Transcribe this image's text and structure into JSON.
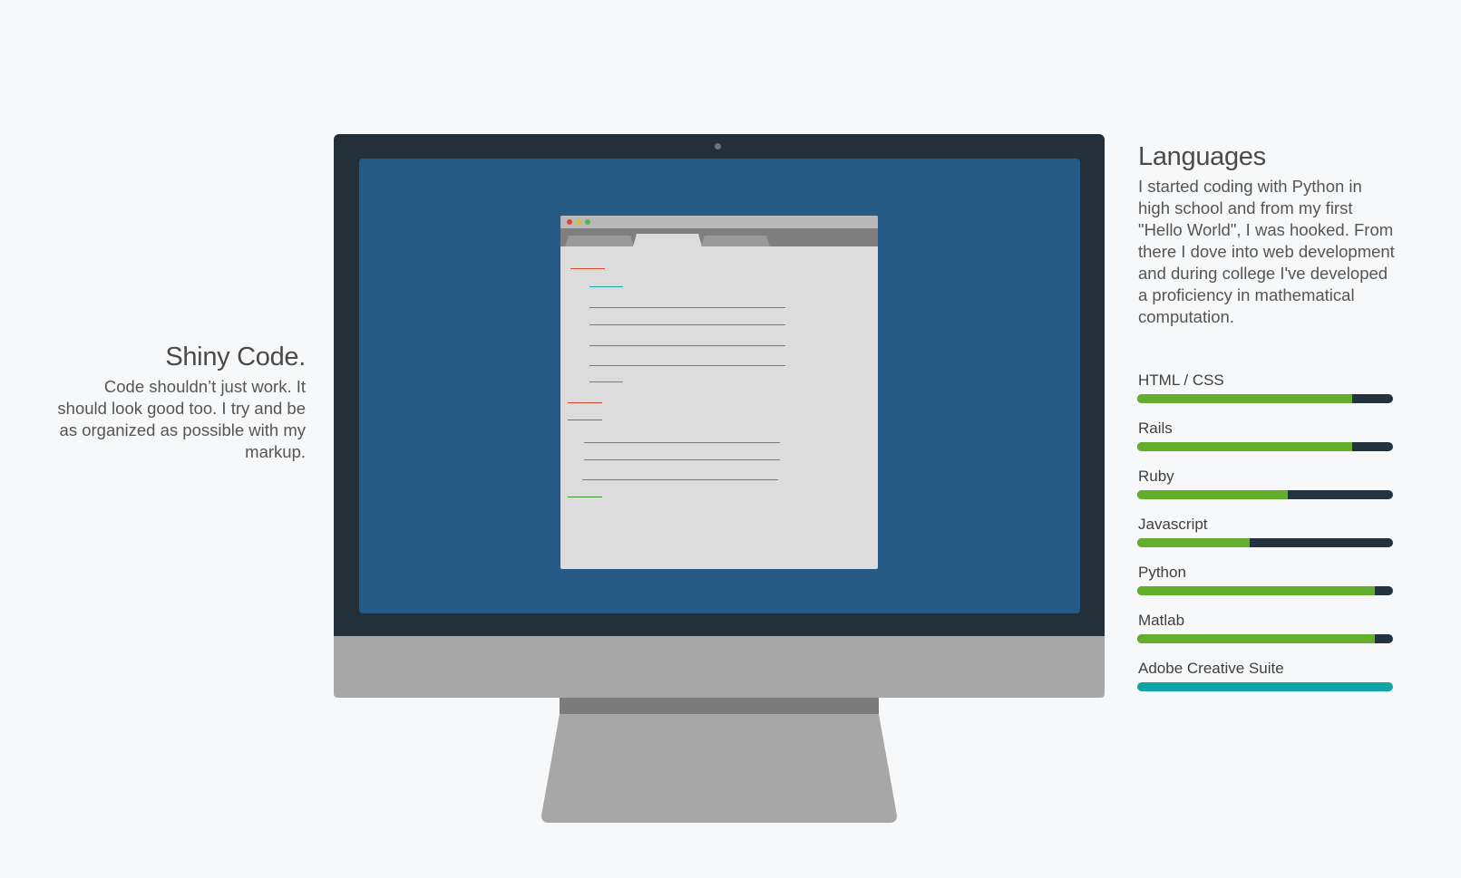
{
  "left": {
    "title": "Shiny Code.",
    "description": "Code shouldn’t just work. It should look good too. I try and be as organized as possible with my markup."
  },
  "right": {
    "title": "Languages",
    "description": "I started coding with Python in high school and from my first \"Hello World\", I was hooked. From there I dove into web development and during college I've developed a proficiency in mathematical computation."
  },
  "skills": [
    {
      "label": "HTML / CSS",
      "level": 0.84,
      "color": "#63ae2c",
      "track": "#243340"
    },
    {
      "label": "Rails",
      "level": 0.84,
      "color": "#63ae2c",
      "track": "#243340"
    },
    {
      "label": "Ruby",
      "level": 0.59,
      "color": "#63ae2c",
      "track": "#243340"
    },
    {
      "label": "Javascript",
      "level": 0.44,
      "color": "#63ae2c",
      "track": "#243340"
    },
    {
      "label": "Python",
      "level": 0.93,
      "color": "#63ae2c",
      "track": "#243340"
    },
    {
      "label": "Matlab",
      "level": 0.93,
      "color": "#63ae2c",
      "track": "#243340"
    },
    {
      "label": "Adobe Creative Suite",
      "level": 1.0,
      "color": "#10a3a8",
      "track": "#10a3a8"
    }
  ],
  "colors": {
    "background": "#f7f8f9",
    "bezel": "#232f39",
    "screen": "#275b85",
    "chin": "#a7a7a7",
    "green_fill": "#63ae2c",
    "teal_fill": "#10a3a8"
  }
}
